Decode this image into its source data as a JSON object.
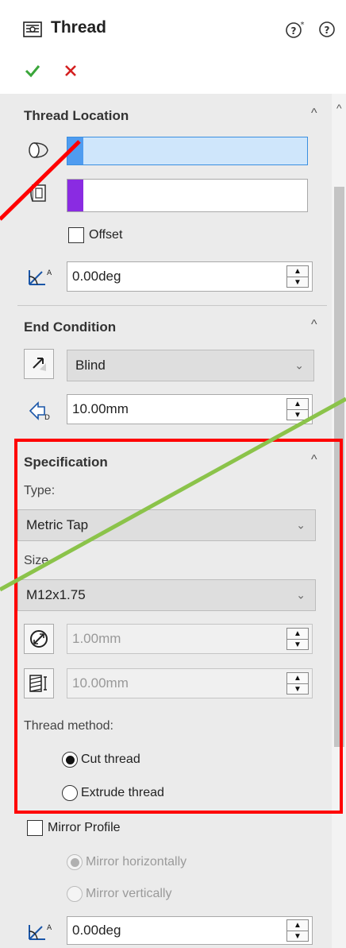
{
  "header": {
    "title": "Thread",
    "confirm_icon": "checkmark-icon",
    "cancel_icon": "close-icon",
    "help_tip_icon": "what-is-wrong-help-icon",
    "help_icon": "help-icon"
  },
  "thread_location": {
    "title": "Thread Location",
    "edge_selection": {
      "value": "",
      "swatch_color": "#4f9cf0"
    },
    "face_selection": {
      "value": "",
      "swatch_color": "#8a2be2"
    },
    "offset_label": "Offset",
    "offset_checked": false,
    "start_angle": "0.00deg"
  },
  "end_condition": {
    "title": "End Condition",
    "type": "Blind",
    "depth": "10.00mm"
  },
  "specification": {
    "title": "Specification",
    "type_label": "Type:",
    "type_value": "Metric Tap",
    "size_label": "Size",
    "size_value": "M12x1.75",
    "diameter_override": "1.00mm",
    "pitch_override": "10.00mm",
    "thread_method_label": "Thread method:",
    "methods": [
      {
        "label": "Cut thread",
        "selected": true
      },
      {
        "label": "Extrude thread",
        "selected": false
      }
    ]
  },
  "mirror": {
    "label": "Mirror Profile",
    "checked": false,
    "options": [
      {
        "label": "Mirror horizontally",
        "selected": true
      },
      {
        "label": "Mirror vertically",
        "selected": false
      }
    ],
    "rotation_angle": "0.00deg"
  },
  "annotations": {
    "highlight_color": "#ff0000",
    "red_arrow_color": "#ff0000",
    "green_arrow_color": "#8bc34a"
  }
}
